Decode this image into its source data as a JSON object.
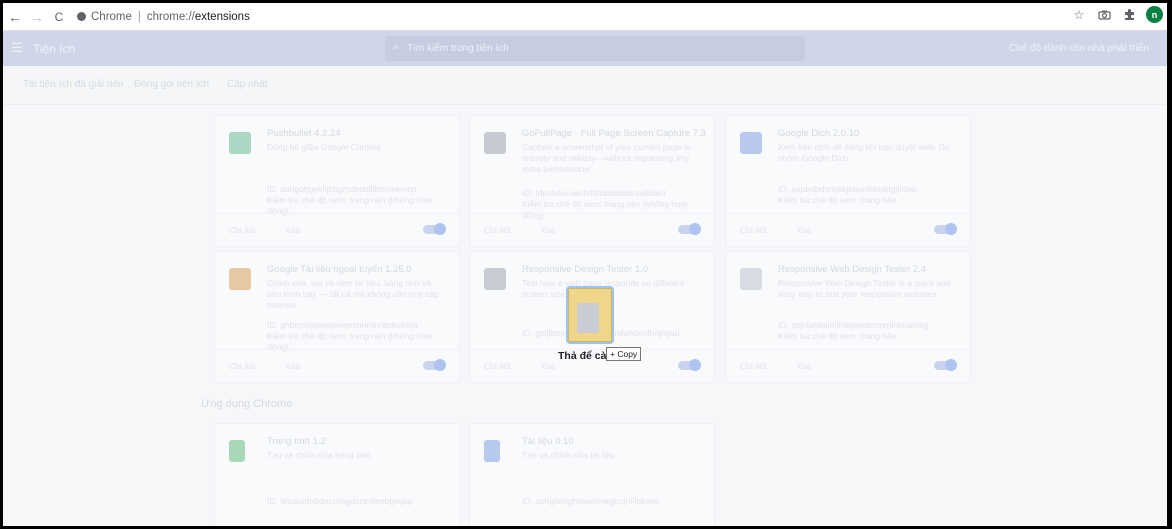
{
  "browser": {
    "back": "←",
    "forward": "→",
    "reload": "C",
    "site_chip": "Chrome",
    "url_prefix": "chrome://",
    "url_path": "extensions"
  },
  "header": {
    "title": "Tiện ích",
    "search_placeholder": "Tìm kiếm trong tiện ích",
    "dev_mode_label": "Chế độ dành cho nhà phát triển"
  },
  "subbar": {
    "load_unpacked": "Tải tiện ích đã giải nén",
    "pack_extension": "Đóng gói tiện ích",
    "update": "Cập nhật"
  },
  "cards": [
    {
      "name": "Pushbullet 4.3.24",
      "desc": "Đồng bộ giữa Google Chrome",
      "id": "ID: abhgohgekfijbbgmdbphiflbmoekmcn\nKiểm tra chế độ xem: trang nền (không hoạt động)",
      "details": "Chi tiết",
      "remove": "Xóa",
      "color": "#a9d9c2"
    },
    {
      "name": "GoFullPage - Full Page Screen Capture 7.3",
      "desc": "Capture a screenshot of your current page in entirety and reliably—without requesting any extra permissions!",
      "id": "ID: fdpohaocaechififmbbbbbknoalclacl\nKiểm tra chế độ xem: trang nền (không hoạt động)",
      "details": "Chi tiết",
      "remove": "Xóa",
      "color": "#c7cad1"
    },
    {
      "name": "Google Dịch 2.0.10",
      "desc": "Xem bản dịch dễ dàng khi bạn duyệt web. Do nhóm Google Dịch.",
      "id": "ID: aapbdbdomjkkjkaonfhkkikfgjllcleb\nKiểm tra chế độ xem: trang nền",
      "details": "Chi tiết",
      "remove": "Xóa",
      "color": "#b8c8ee"
    },
    {
      "name": "Google Tài liệu ngoại tuyến 1.25.0",
      "desc": "Chỉnh sửa, tạo và xem tài liệu, bảng tính và bản trình bày — tất cả mà không cần truy cập Internet.",
      "id": "ID: ghbmnnjooekpmoecnnnilnnbdlolhkhi\nKiểm tra chế độ xem: trang nền (không hoạt động)",
      "details": "Chi tiết",
      "remove": "Xóa",
      "color": "#e6c9a3"
    },
    {
      "name": "Responsive Design Tester 1.0",
      "desc": "Test how a web page responds on different screen sizes.",
      "id": "ID: gbljfbmmnmoaphppgmlahdeofnojmjad",
      "details": "Chi tiết",
      "remove": "Xóa",
      "color": "#c8cbd2"
    },
    {
      "name": "Responsive Web Design Tester 2.4",
      "desc": "Responsive Web Design Tester is a quick and easy way to test your responsive websites.",
      "id": "ID: objclahbaimlfnbjdeobicmmlnbhamkg\nKiểm tra chế độ xem: trang nền",
      "details": "Chi tiết",
      "remove": "Xóa",
      "color": "#d8dbe2"
    }
  ],
  "apps_section_title": "Ứng dụng Chrome",
  "apps": [
    {
      "name": "Trang tính 1.2",
      "desc": "Tạo và chỉnh sửa bảng tính",
      "id": "ID: felcaaldnbdncclmgdcncolpebgiejap",
      "color": "#a8d8b5"
    },
    {
      "name": "Tài liệu 0.10",
      "desc": "Tạo và chỉnh sửa tài liệu",
      "id": "ID: aohghmighlieiainnegkcijnfilokake",
      "color": "#b6c9ef"
    }
  ],
  "drag": {
    "drop_label": "Thả để cài đặt",
    "copy_label": "+ Copy"
  }
}
